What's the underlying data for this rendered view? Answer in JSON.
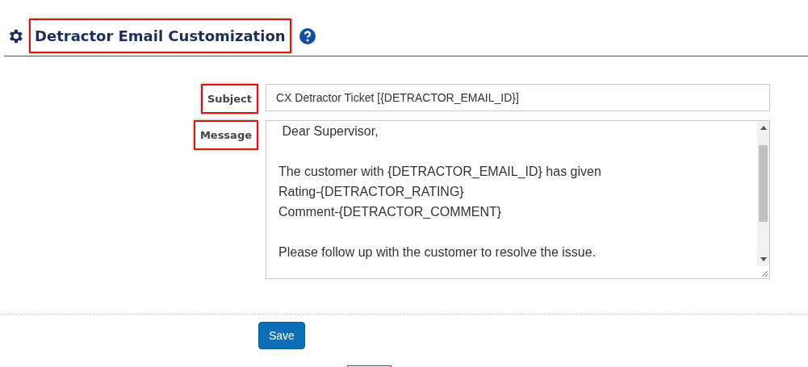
{
  "header": {
    "title": "Detractor Email Customization",
    "title_highlighted": true
  },
  "form": {
    "fields": [
      {
        "label": "Subject",
        "kind": "input",
        "highlighted": true,
        "value": "CX Detractor Ticket [{DETRACTOR_EMAIL_ID}]"
      },
      {
        "label": "Message",
        "kind": "textarea",
        "highlighted": true,
        "value": " Dear Supervisor,\n\nThe customer with {DETRACTOR_EMAIL_ID} has given\nRating-{DETRACTOR_RATING}\nComment-{DETRACTOR_COMMENT}\n\nPlease follow up with the customer to resolve the issue."
      }
    ]
  },
  "buttons": [
    {
      "label": "Save"
    }
  ],
  "annotations": [
    {
      "kind": "cut-box"
    }
  ]
}
